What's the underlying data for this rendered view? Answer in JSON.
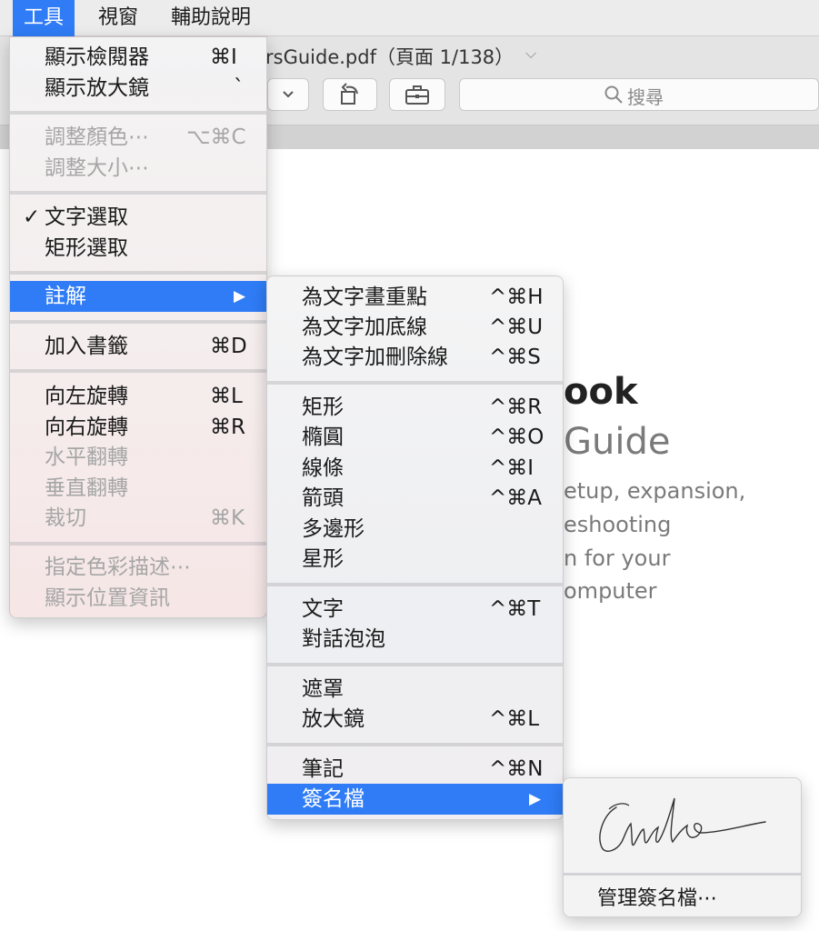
{
  "menubar": {
    "items": [
      "工具",
      "視窗",
      "輔助說明"
    ]
  },
  "window": {
    "doc_title": "rsGuide.pdf（頁面 1/138）",
    "search_label": "搜尋"
  },
  "document": {
    "heading": "ook",
    "subheading": "Guide",
    "lines": [
      "etup, expansion,",
      "eshooting",
      "n for your",
      "omputer"
    ]
  },
  "tools_menu": {
    "items": [
      {
        "label": "顯示檢閱器",
        "shortcut": "⌘I",
        "state": "normal"
      },
      {
        "label": "顯示放大鏡",
        "shortcut": "`",
        "state": "normal"
      },
      {
        "label": "調整顏色⋯",
        "shortcut": "⌥⌘C",
        "state": "disabled"
      },
      {
        "label": "調整大小⋯",
        "shortcut": "",
        "state": "disabled"
      },
      {
        "label": "文字選取",
        "shortcut": "",
        "state": "checked",
        "check": "✓"
      },
      {
        "label": "矩形選取",
        "shortcut": "",
        "state": "normal"
      },
      {
        "label": "註解",
        "shortcut": "",
        "state": "selected",
        "submenu": "▶"
      },
      {
        "label": "加入書籤",
        "shortcut": "⌘D",
        "state": "normal"
      },
      {
        "label": "向左旋轉",
        "shortcut": "⌘L",
        "state": "normal"
      },
      {
        "label": "向右旋轉",
        "shortcut": "⌘R",
        "state": "normal"
      },
      {
        "label": "水平翻轉",
        "shortcut": "",
        "state": "disabled"
      },
      {
        "label": "垂直翻轉",
        "shortcut": "",
        "state": "disabled"
      },
      {
        "label": "裁切",
        "shortcut": "⌘K",
        "state": "disabled"
      },
      {
        "label": "指定色彩描述⋯",
        "shortcut": "",
        "state": "disabled"
      },
      {
        "label": "顯示位置資訊",
        "shortcut": "",
        "state": "disabled"
      }
    ]
  },
  "annotate_menu": {
    "items": [
      {
        "label": "為文字畫重點",
        "shortcut": "^⌘H"
      },
      {
        "label": "為文字加底線",
        "shortcut": "^⌘U"
      },
      {
        "label": "為文字加刪除線",
        "shortcut": "^⌘S"
      },
      {
        "label": "矩形",
        "shortcut": "^⌘R"
      },
      {
        "label": "橢圓",
        "shortcut": "^⌘O"
      },
      {
        "label": "線條",
        "shortcut": "^⌘I"
      },
      {
        "label": "箭頭",
        "shortcut": "^⌘A"
      },
      {
        "label": "多邊形",
        "shortcut": ""
      },
      {
        "label": "星形",
        "shortcut": ""
      },
      {
        "label": "文字",
        "shortcut": "^⌘T"
      },
      {
        "label": "對話泡泡",
        "shortcut": ""
      },
      {
        "label": "遮罩",
        "shortcut": ""
      },
      {
        "label": "放大鏡",
        "shortcut": "^⌘L"
      },
      {
        "label": "筆記",
        "shortcut": "^⌘N"
      },
      {
        "label": "簽名檔",
        "shortcut": "",
        "submenu": "▶"
      }
    ]
  },
  "signature_menu": {
    "manage_label": "管理簽名檔⋯"
  },
  "colors": {
    "accent": "#2f7cf6",
    "disabled_text": "#a6a6a6"
  }
}
